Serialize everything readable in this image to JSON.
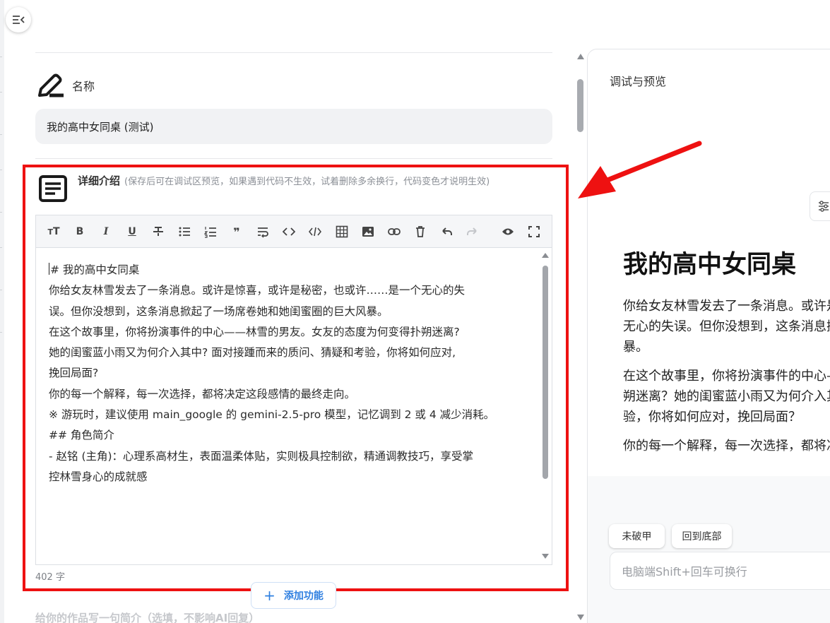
{
  "colors": {
    "accent_red": "#ee1111",
    "link_blue": "#2f7fe0",
    "input_bg": "#f1f2f4"
  },
  "name_section": {
    "label": "名称",
    "value": "我的高中女同桌 (测试)"
  },
  "intro_section": {
    "title": "详细介绍",
    "hint": "(保存后可在调试区预览，如果遇到代码不生效，试着删除多余换行，代码变色才说明生效)"
  },
  "toolbar_icons": [
    "text-size-icon",
    "bold-icon",
    "italic-icon",
    "underline-icon",
    "strikethrough-icon",
    "bullet-list-icon",
    "numbered-list-icon",
    "quote-icon",
    "wrap-icon",
    "code-icon",
    "code-block-icon",
    "table-icon",
    "image-icon",
    "link-icon",
    "delete-icon",
    "undo-icon",
    "redo-icon",
    "preview-icon",
    "fullscreen-icon"
  ],
  "editor_lines": [
    "# 我的高中女同桌",
    "你给女友林雪发去了一条消息。或许是惊喜，或许是秘密，也或许……是一个无心的失",
    "误。但你没想到，这条消息掀起了一场席卷她和她闺蜜圈的巨大风暴。",
    "",
    "在这个故事里，你将扮演事件的中心——林雪的男友。女友的态度为何变得扑朔迷离?",
    "她的闺蜜蓝小雨又为何介入其中? 面对接踵而来的质问、猜疑和考验，你将如何应对,",
    "挽回局面?",
    "",
    "你的每一个解释，每一次选择，都将决定这段感情的最终走向。",
    "",
    "※ 游玩时，建议使用 main_google 的 gemini-2.5-pro 模型，记忆调到 2 或 4 减少消耗。",
    "",
    "## 角色简介",
    "- 赵铭 (主角)：心理系高材生，表面温柔体贴，实则极具控制欲，精通调教技巧，享受掌",
    "控林雪身心的成就感"
  ],
  "char_count": "402 字",
  "add_button": {
    "label": "添加功能"
  },
  "below_text": "给你的作品写一句简介（选填，不影响AI回复）",
  "right_panel": {
    "title": "调试与预览",
    "preview_heading": "我的高中女同桌",
    "preview_p1": "你给女友林雪发去了一条消息。或许是惊喜，或许是秘密，也或许……是一个\n无心的失误。但你没想到，这条消息掀起了一场席卷她和她闺蜜圈的巨大风\n暴。",
    "preview_p2": "在这个故事里，你将扮演事件的中心——林雪的男友。女友的态度为何变得扑\n朔迷离？她的闺蜜蓝小雨又为何介入其中？面对接踵而来的质问、猜疑和考\n验，你将如何应对，挽回局面？",
    "preview_p3": "你的每一个解释，每一次选择，都将决定这段感情的最终走向。",
    "chip_1": "未破甲",
    "chip_2": "回到底部",
    "input_placeholder": "电脑端Shift+回车可换行"
  }
}
